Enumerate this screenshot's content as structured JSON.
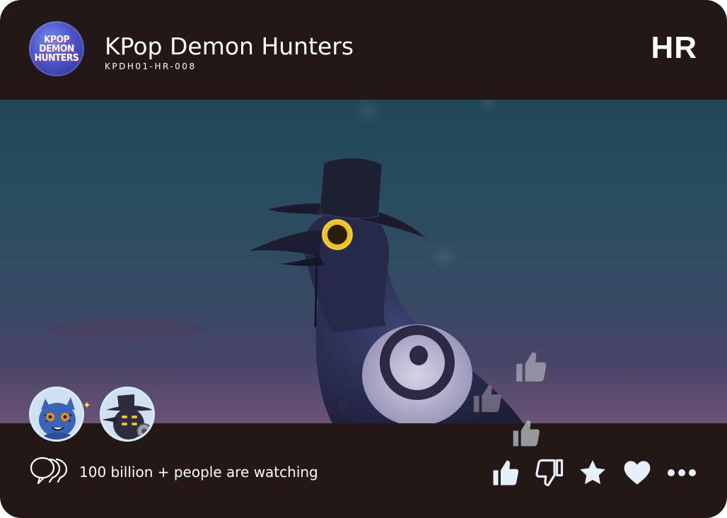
{
  "header": {
    "logo_lines": [
      "KPOP",
      "DEMON",
      "HUNTERS"
    ],
    "title": "KPop Demon Hunters",
    "code": "KPDH01-HR-008",
    "rarity": "HR"
  },
  "scene": {
    "subject_icon": "crow-with-hat-icon",
    "floating_reactions": [
      "thumbs-up-icon",
      "thumbs-up-icon",
      "thumbs-up-icon"
    ]
  },
  "avatars": [
    {
      "icon": "tiger-avatar-icon"
    },
    {
      "icon": "crow-avatar-icon"
    }
  ],
  "footer": {
    "viewers_icon": "speech-bubbles-icon",
    "viewers_text": "100 billion + people are watching",
    "actions": [
      {
        "icon": "thumbs-up-icon",
        "label": "like"
      },
      {
        "icon": "thumbs-down-icon",
        "label": "dislike"
      },
      {
        "icon": "star-icon",
        "label": "favorite"
      },
      {
        "icon": "heart-icon",
        "label": "love"
      },
      {
        "icon": "more-icon",
        "label": "more"
      }
    ]
  },
  "colors": {
    "frame": "#231816",
    "text": "#ffffff",
    "icon": "#e6f0fb",
    "eye": "#f2c21b"
  }
}
